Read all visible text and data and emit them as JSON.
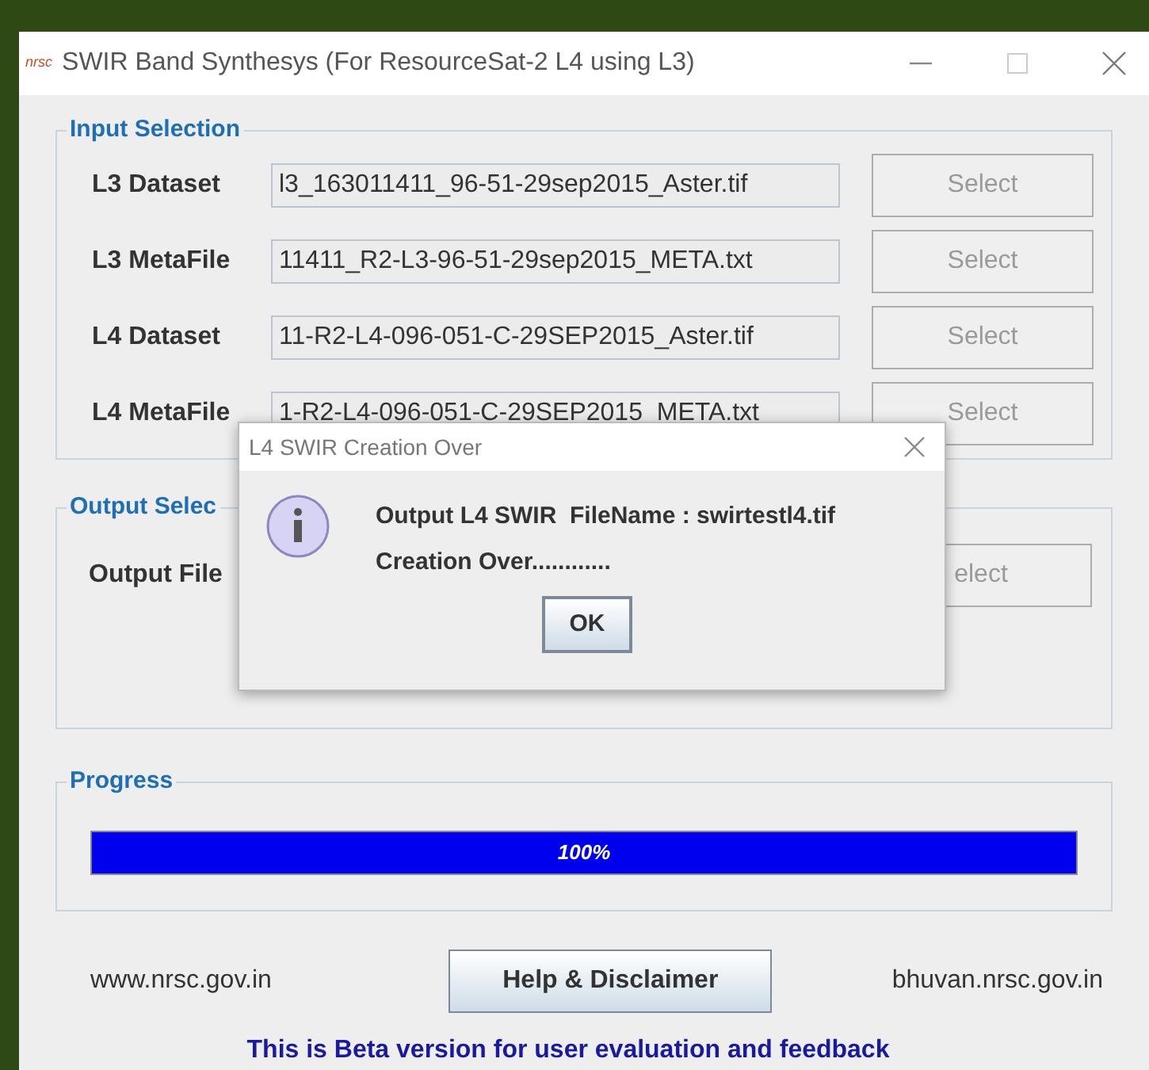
{
  "window": {
    "logo": "nrsc",
    "title": "SWIR Band Synthesys (For ResourceSat-2 L4 using L3)"
  },
  "input_selection": {
    "legend": "Input Selection",
    "rows": [
      {
        "label": "L3 Dataset",
        "value": "l3_163011411_96-51-29sep2015_Aster.tif",
        "button": "Select"
      },
      {
        "label": "L3 MetaFile",
        "value": "11411_R2-L3-96-51-29sep2015_META.txt",
        "button": "Select"
      },
      {
        "label": "L4 Dataset",
        "value": "11-R2-L4-096-051-C-29SEP2015_Aster.tif",
        "button": "Select"
      },
      {
        "label": "L4 MetaFile",
        "value": "1-R2-L4-096-051-C-29SEP2015_META.txt",
        "button": "Select"
      }
    ]
  },
  "output_selection": {
    "legend": "Output Selec",
    "label": "Output File",
    "button": "elect"
  },
  "progress": {
    "legend": "Progress",
    "level": 1,
    "reading": "100%"
  },
  "footer": {
    "left_link": "www.nrsc.gov.in",
    "help_button": "Help & Disclaimer",
    "right_link": "bhuvan.nrsc.gov.in",
    "note": "This is Beta version for user evaluation and feedback"
  },
  "dialog": {
    "title": "L4 SWIR Creation Over",
    "lines": [
      "Output L4 SWIR  FileName : swirtestl4.tif",
      "Creation Over............"
    ],
    "button": "OK"
  }
}
